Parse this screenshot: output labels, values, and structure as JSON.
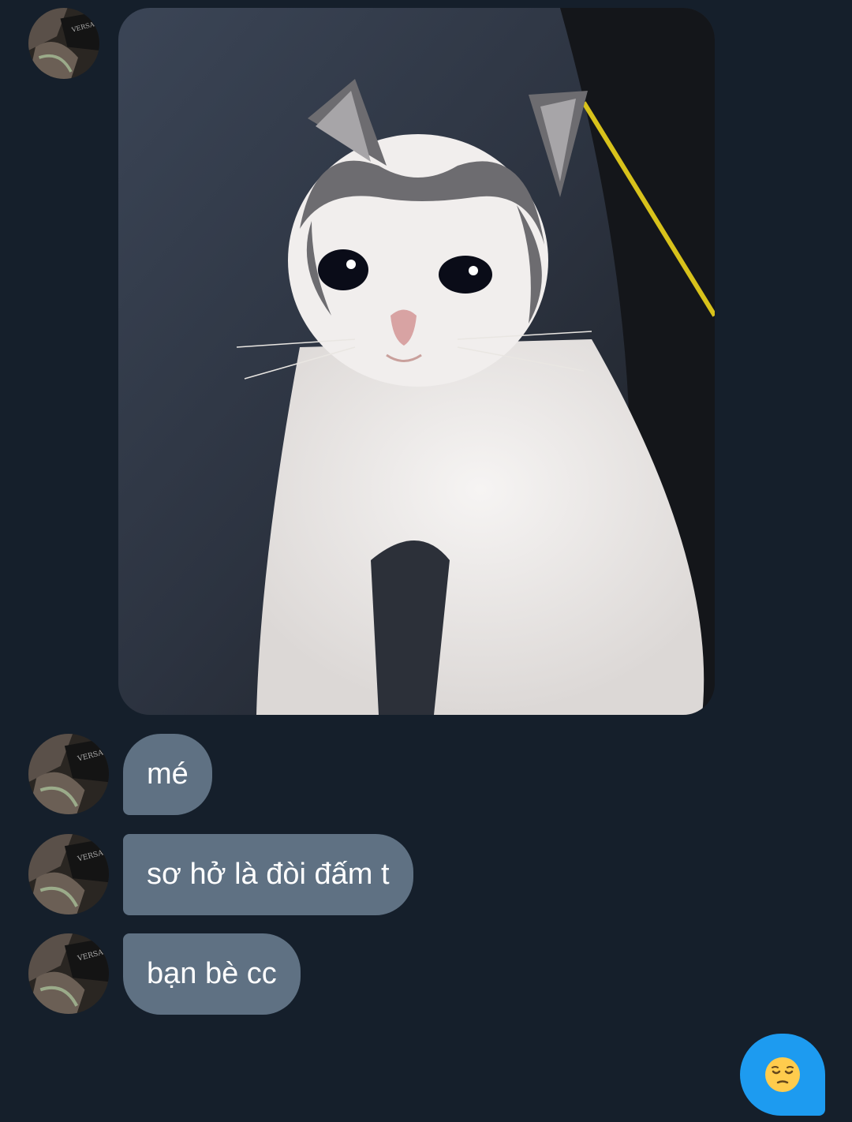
{
  "messages": [
    {
      "type": "image",
      "sender": "other",
      "image": "crying-cat-photo"
    },
    {
      "type": "text",
      "sender": "other",
      "text": "mé"
    },
    {
      "type": "text",
      "sender": "other",
      "text": "sơ hở là đòi đấm t"
    },
    {
      "type": "text",
      "sender": "other",
      "text": "bạn bè cc"
    },
    {
      "type": "emoji",
      "sender": "me",
      "icon": "pensive-face-icon"
    }
  ],
  "colors": {
    "background": "#151f2b",
    "incoming_bubble": "#5f7183",
    "outgoing_bubble": "#1d9bf0"
  }
}
